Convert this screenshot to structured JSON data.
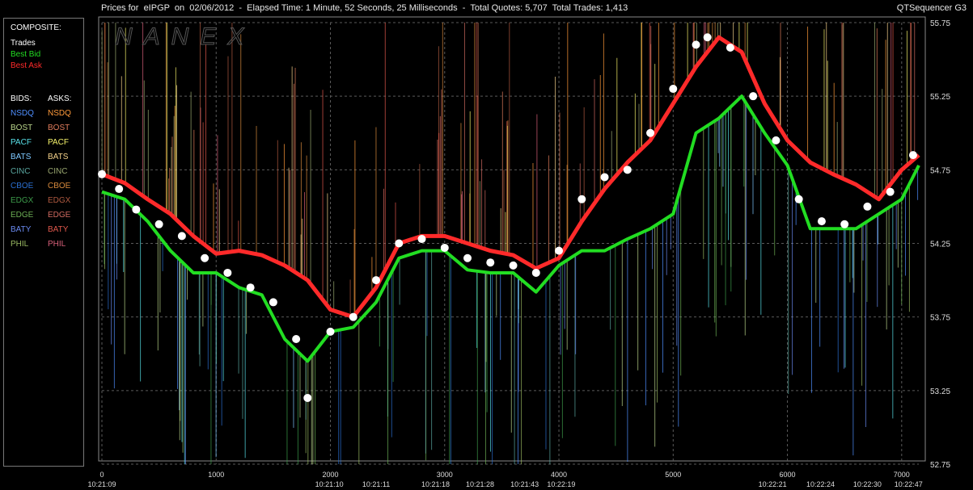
{
  "header": {
    "title": "Prices for  eIPGP  on  02/06/2012  -  Elapsed Time: 1 Minute, 52 Seconds, 25 Milliseconds  -  Total Quotes: 5,707  Total Trades: 1,413",
    "app_name": "QTSequencer G3"
  },
  "watermark": "NANEX",
  "legend": {
    "composite_heading": "COMPOSITE:",
    "composite_items": [
      {
        "label": "Trades",
        "color": "#ffffff"
      },
      {
        "label": "Best Bid",
        "color": "#22dd22"
      },
      {
        "label": "Best Ask",
        "color": "#ff2a2a"
      }
    ],
    "bids_heading": "BIDS:",
    "asks_heading": "ASKS:",
    "bids": [
      {
        "label": "NSDQ",
        "color": "#4f8fff"
      },
      {
        "label": "BOST",
        "color": "#b9d48a"
      },
      {
        "label": "PACF",
        "color": "#58e0e8"
      },
      {
        "label": "BATS",
        "color": "#7ec8ff"
      },
      {
        "label": "CINC",
        "color": "#5aa7a0"
      },
      {
        "label": "CBOE",
        "color": "#2b6fd0"
      },
      {
        "label": "EDGX",
        "color": "#3c9a4a"
      },
      {
        "label": "EDGE",
        "color": "#6cae55"
      },
      {
        "label": "BATY",
        "color": "#6a8af0"
      },
      {
        "label": "PHIL",
        "color": "#9aba62"
      }
    ],
    "asks": [
      {
        "label": "NSDQ",
        "color": "#ff9a3a"
      },
      {
        "label": "BOST",
        "color": "#e07c5c"
      },
      {
        "label": "PACF",
        "color": "#f5f26a"
      },
      {
        "label": "BATS",
        "color": "#f5d28a"
      },
      {
        "label": "CINC",
        "color": "#9aa870"
      },
      {
        "label": "CBOE",
        "color": "#d88a3c"
      },
      {
        "label": "EDGX",
        "color": "#b05a40"
      },
      {
        "label": "EDGE",
        "color": "#d06a60"
      },
      {
        "label": "BATY",
        "color": "#e0584c"
      },
      {
        "label": "PHIL",
        "color": "#d8607a"
      }
    ]
  },
  "chart_data": {
    "type": "line",
    "ylim": [
      52.75,
      55.75
    ],
    "xlim": [
      0,
      7150
    ],
    "y_ticks": [
      "55.75",
      "55.25",
      "54.75",
      "54.25",
      "53.75",
      "53.25",
      "52.75"
    ],
    "y_tick_values": [
      55.75,
      55.25,
      54.75,
      54.25,
      53.75,
      53.25,
      52.75
    ],
    "x_ticks": [
      "0",
      "1000",
      "2000",
      "3000",
      "4000",
      "5000",
      "6000",
      "7000"
    ],
    "x_tick_values": [
      0,
      1000,
      2000,
      3000,
      4000,
      5000,
      6000,
      7000
    ],
    "time_labels": [
      {
        "x": 0,
        "label": "10:21:09"
      },
      {
        "x": 1990,
        "label": "10:21:10"
      },
      {
        "x": 2400,
        "label": "10:21:11"
      },
      {
        "x": 2920,
        "label": "10:21:18"
      },
      {
        "x": 3310,
        "label": "10:21:28"
      },
      {
        "x": 3700,
        "label": "10:21:43"
      },
      {
        "x": 4020,
        "label": "10:22:19"
      },
      {
        "x": 5870,
        "label": "10:22:21"
      },
      {
        "x": 6290,
        "label": "10:22:24"
      },
      {
        "x": 6700,
        "label": "10:22:30"
      },
      {
        "x": 7060,
        "label": "10:22:47"
      }
    ],
    "series": [
      {
        "name": "Best Ask",
        "color": "#ff2a2a",
        "x": [
          0,
          200,
          400,
          600,
          800,
          1000,
          1200,
          1400,
          1600,
          1800,
          2000,
          2200,
          2400,
          2600,
          2800,
          3000,
          3200,
          3400,
          3600,
          3800,
          4000,
          4200,
          4400,
          4600,
          4800,
          5000,
          5200,
          5400,
          5600,
          5800,
          6000,
          6200,
          6400,
          6600,
          6800,
          7000,
          7150
        ],
        "y": [
          54.72,
          54.66,
          54.55,
          54.45,
          54.3,
          54.18,
          54.2,
          54.17,
          54.1,
          54.0,
          53.8,
          53.75,
          53.95,
          54.25,
          54.3,
          54.3,
          54.25,
          54.2,
          54.17,
          54.08,
          54.15,
          54.4,
          54.62,
          54.8,
          54.95,
          55.2,
          55.45,
          55.65,
          55.55,
          55.2,
          54.95,
          54.8,
          54.72,
          54.65,
          54.55,
          54.75,
          54.85
        ]
      },
      {
        "name": "Best Bid",
        "color": "#22dd22",
        "x": [
          0,
          200,
          400,
          600,
          800,
          1000,
          1200,
          1400,
          1600,
          1800,
          2000,
          2200,
          2400,
          2600,
          2800,
          3000,
          3200,
          3400,
          3600,
          3800,
          4000,
          4200,
          4400,
          4600,
          4800,
          5000,
          5200,
          5400,
          5600,
          5800,
          6000,
          6200,
          6400,
          6600,
          6800,
          7000,
          7150
        ],
        "y": [
          54.6,
          54.55,
          54.4,
          54.2,
          54.05,
          54.05,
          53.95,
          53.9,
          53.6,
          53.45,
          53.65,
          53.68,
          53.85,
          54.15,
          54.2,
          54.2,
          54.07,
          54.05,
          54.05,
          53.92,
          54.1,
          54.2,
          54.2,
          54.28,
          54.35,
          54.45,
          55.0,
          55.1,
          55.25,
          55.0,
          54.78,
          54.35,
          54.35,
          54.35,
          54.45,
          54.55,
          54.78
        ]
      },
      {
        "name": "Trades",
        "color": "#ffffff",
        "x": [
          0,
          150,
          300,
          500,
          700,
          900,
          1100,
          1300,
          1500,
          1700,
          1800,
          2000,
          2200,
          2400,
          2600,
          2800,
          3000,
          3200,
          3400,
          3600,
          3800,
          4000,
          4200,
          4400,
          4600,
          4800,
          5000,
          5200,
          5300,
          5500,
          5700,
          5900,
          6100,
          6300,
          6500,
          6700,
          6900,
          7100
        ],
        "y": [
          54.72,
          54.62,
          54.48,
          54.38,
          54.3,
          54.15,
          54.05,
          53.95,
          53.85,
          53.6,
          53.2,
          53.65,
          53.75,
          54.0,
          54.25,
          54.28,
          54.22,
          54.15,
          54.12,
          54.1,
          54.05,
          54.2,
          54.55,
          54.7,
          54.75,
          55.0,
          55.3,
          55.6,
          55.65,
          55.58,
          55.25,
          54.95,
          54.55,
          54.4,
          54.38,
          54.5,
          54.6,
          54.85
        ]
      }
    ]
  }
}
